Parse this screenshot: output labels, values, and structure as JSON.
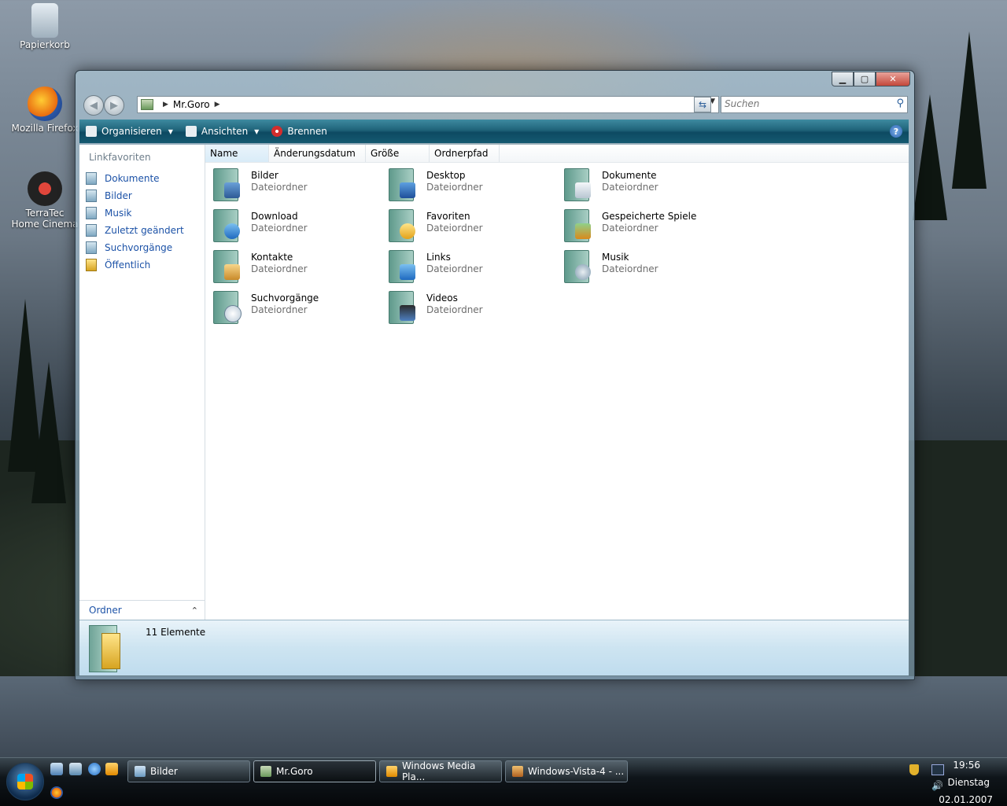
{
  "desktop": {
    "icons": [
      {
        "label": "Papierkorb"
      },
      {
        "label": "Mozilla Firefox"
      },
      {
        "label": "TerraTec Home Cinema"
      }
    ]
  },
  "window": {
    "address": {
      "crumb": "Mr.Goro"
    },
    "search": {
      "placeholder": "Suchen"
    },
    "toolbar": {
      "organize": "Organisieren",
      "views": "Ansichten",
      "burn": "Brennen"
    },
    "nav": {
      "header": "Linkfavoriten",
      "items": [
        {
          "label": "Dokumente"
        },
        {
          "label": "Bilder"
        },
        {
          "label": "Musik"
        },
        {
          "label": "Zuletzt geändert"
        },
        {
          "label": "Suchvorgänge"
        },
        {
          "label": "Öffentlich"
        }
      ],
      "folder_pane": "Ordner"
    },
    "columns": [
      "Name",
      "Änderungsdatum",
      "Größe",
      "Ordnerpfad"
    ],
    "items": [
      {
        "name": "Bilder",
        "type": "Dateiordner"
      },
      {
        "name": "Desktop",
        "type": "Dateiordner"
      },
      {
        "name": "Dokumente",
        "type": "Dateiordner"
      },
      {
        "name": "Download",
        "type": "Dateiordner"
      },
      {
        "name": "Favoriten",
        "type": "Dateiordner"
      },
      {
        "name": "Gespeicherte Spiele",
        "type": "Dateiordner"
      },
      {
        "name": "Kontakte",
        "type": "Dateiordner"
      },
      {
        "name": "Links",
        "type": "Dateiordner"
      },
      {
        "name": "Musik",
        "type": "Dateiordner"
      },
      {
        "name": "Suchvorgänge",
        "type": "Dateiordner"
      },
      {
        "name": "Videos",
        "type": "Dateiordner"
      }
    ],
    "details": {
      "count": "11 Elemente"
    }
  },
  "taskbar": {
    "buttons": [
      {
        "label": "Bilder"
      },
      {
        "label": "Mr.Goro"
      },
      {
        "label": "Windows Media Pla..."
      },
      {
        "label": "Windows-Vista-4 - ..."
      }
    ],
    "clock": {
      "time": "19:56",
      "day": "Dienstag",
      "date": "02.01.2007"
    }
  },
  "colors": {
    "accent": "#1c52a7",
    "toolbar": "#1f6379"
  }
}
